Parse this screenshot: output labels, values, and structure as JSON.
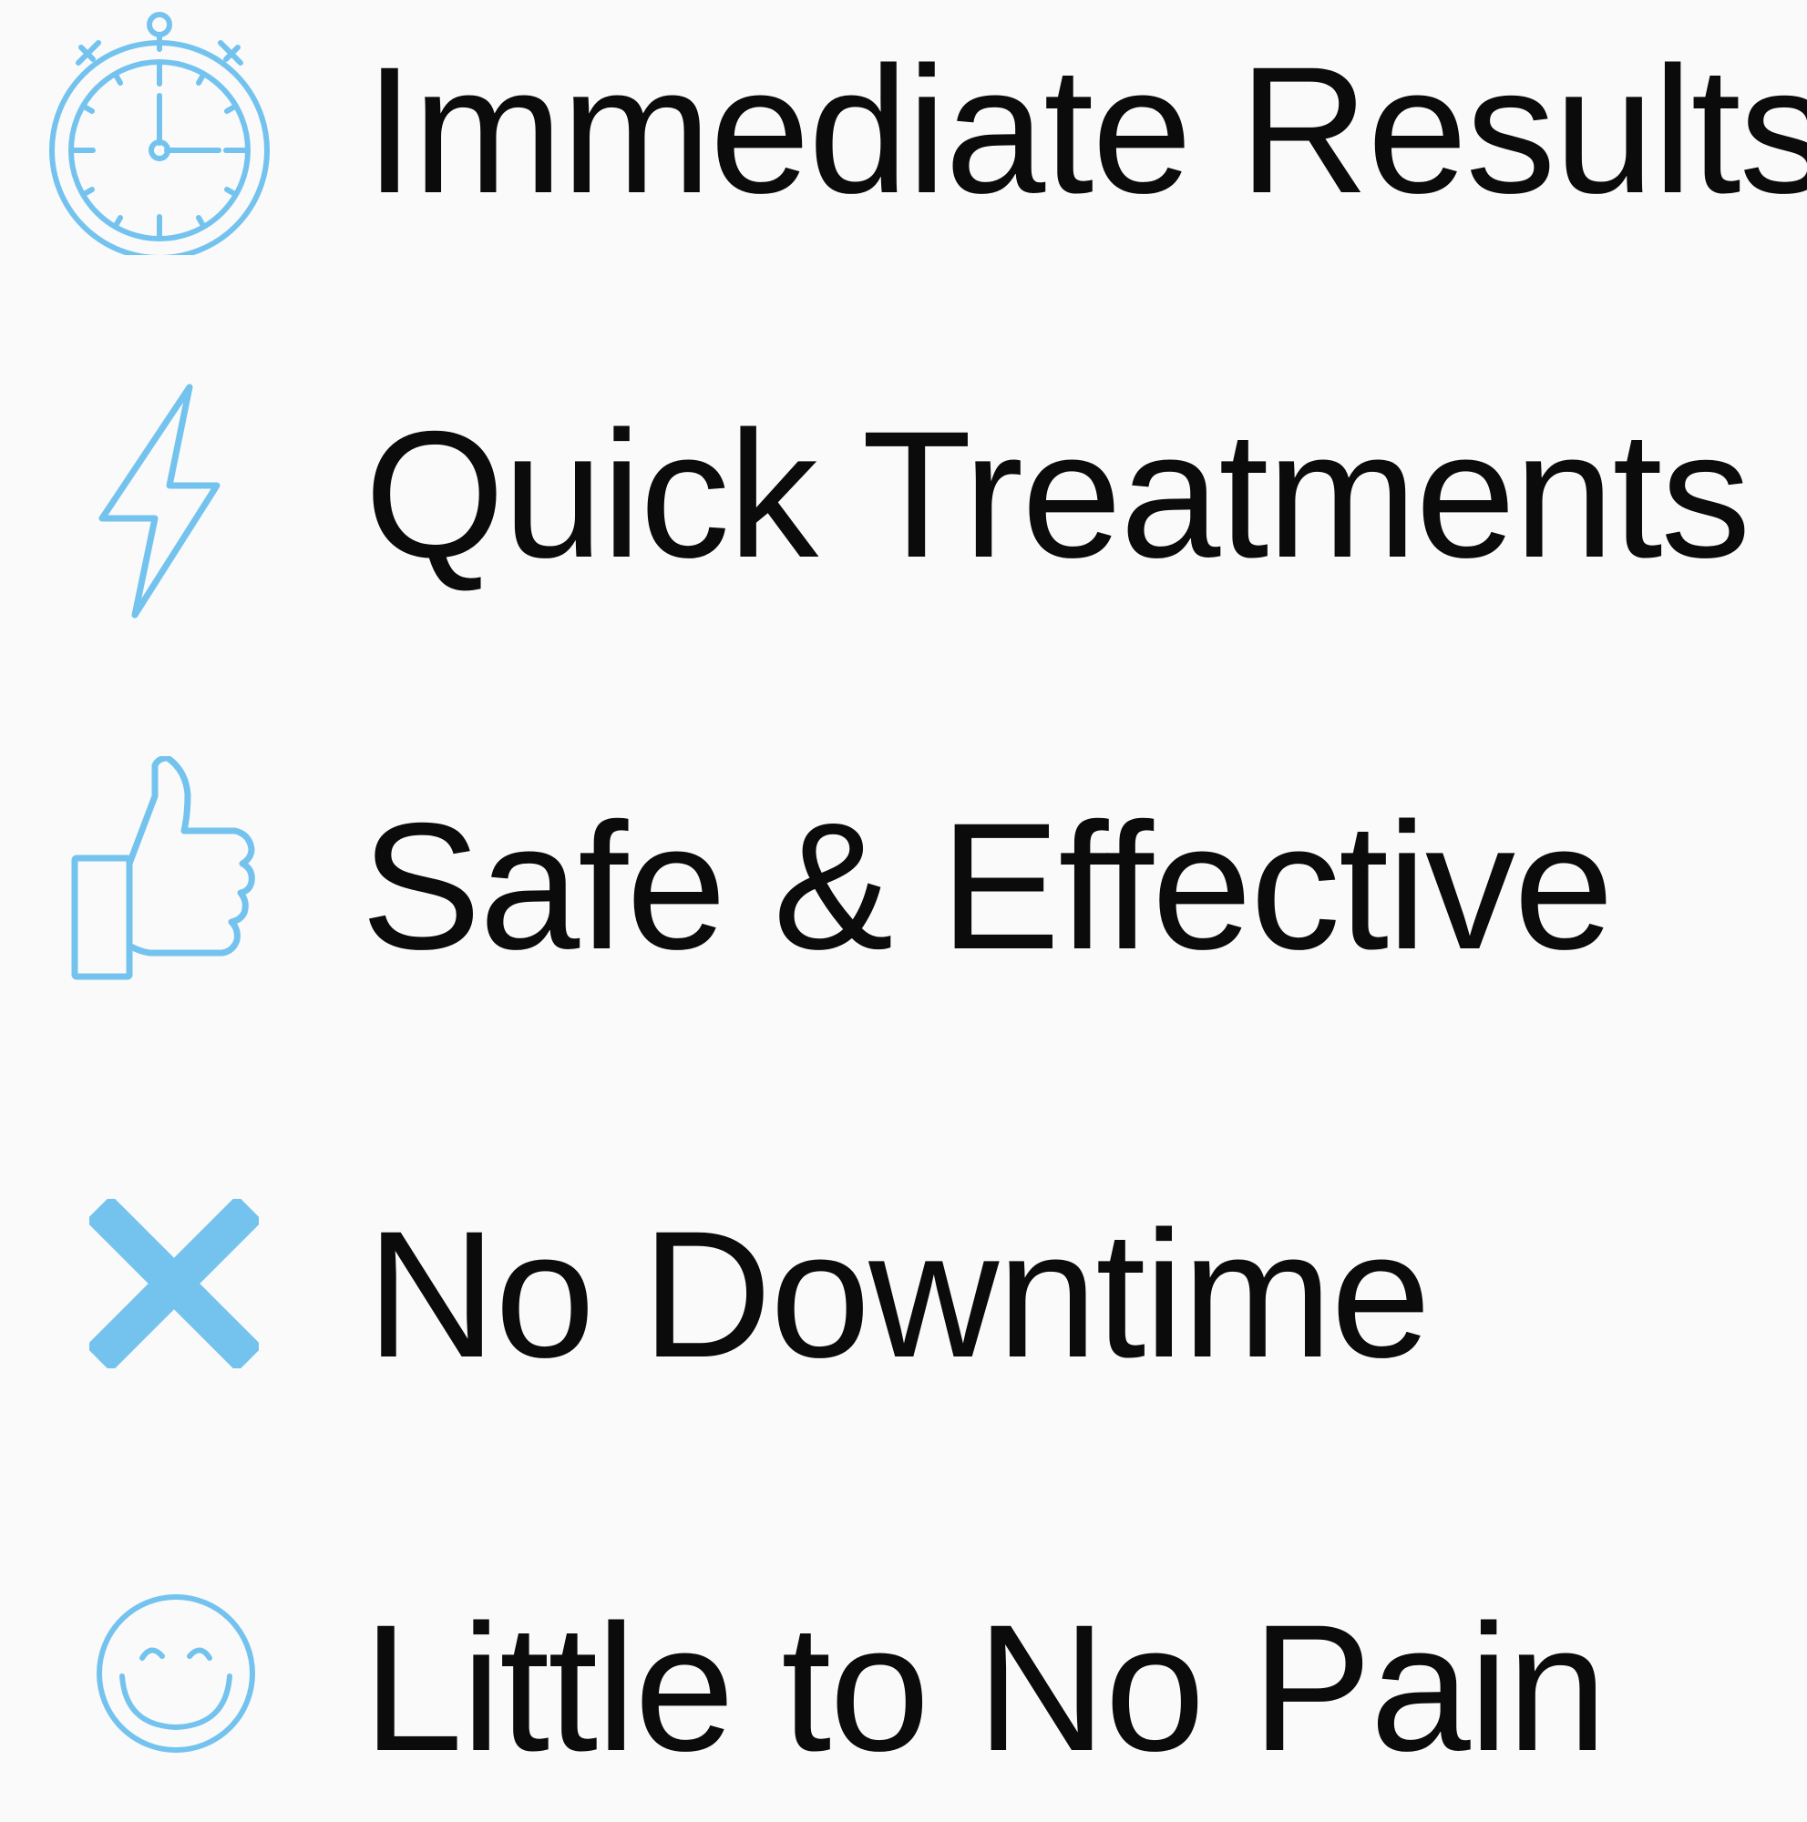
{
  "accent_color": "#74c3ef",
  "text_color": "#0b0b0b",
  "features": [
    {
      "icon": "stopwatch-icon",
      "label": "Immediate Results"
    },
    {
      "icon": "lightning-bolt-icon",
      "label": "Quick Treatments"
    },
    {
      "icon": "thumbs-up-icon",
      "label": "Safe & Effective"
    },
    {
      "icon": "x-mark-icon",
      "label": "No Downtime"
    },
    {
      "icon": "smiley-face-icon",
      "label": "Little to No Pain"
    }
  ]
}
